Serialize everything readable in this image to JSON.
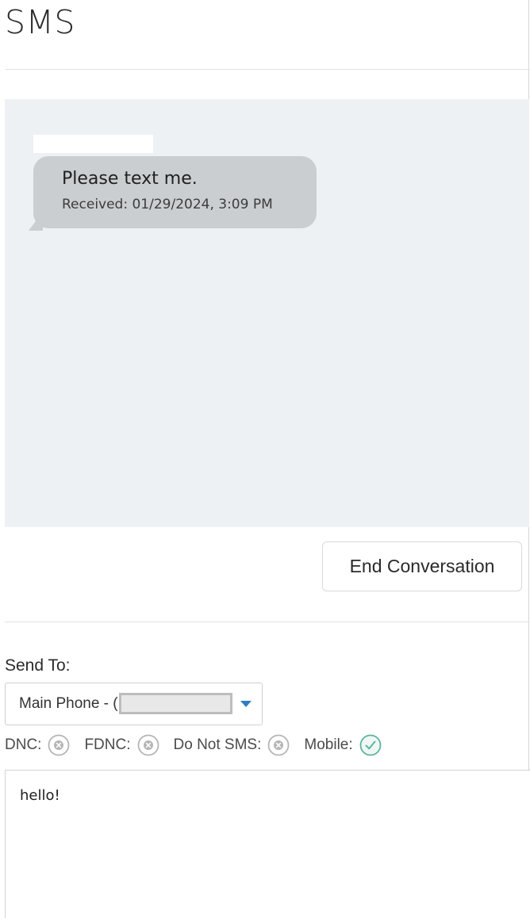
{
  "page": {
    "title": "SMS"
  },
  "thread": {
    "messages": [
      {
        "text": "Please text me.",
        "meta": "Received: 01/29/2024, 3:09 PM"
      }
    ]
  },
  "actions": {
    "end_conversation_label": "End Conversation"
  },
  "send_to": {
    "label": "Send To:",
    "selected": "Main Phone - (",
    "accent_color": "#2f7fc1"
  },
  "flags": [
    {
      "label": "DNC:",
      "state": "off",
      "icon": "x-circle-icon"
    },
    {
      "label": "FDNC:",
      "state": "off",
      "icon": "x-circle-icon"
    },
    {
      "label": "Do Not SMS:",
      "state": "off",
      "icon": "x-circle-icon"
    },
    {
      "label": "Mobile:",
      "state": "on",
      "icon": "check-circle-icon"
    }
  ],
  "compose": {
    "value": "hello!"
  },
  "colors": {
    "thread_background": "#eef1f4",
    "bubble": "#cbced1",
    "check": "#5fb3a0",
    "x_icon": "#b5b5b5"
  }
}
